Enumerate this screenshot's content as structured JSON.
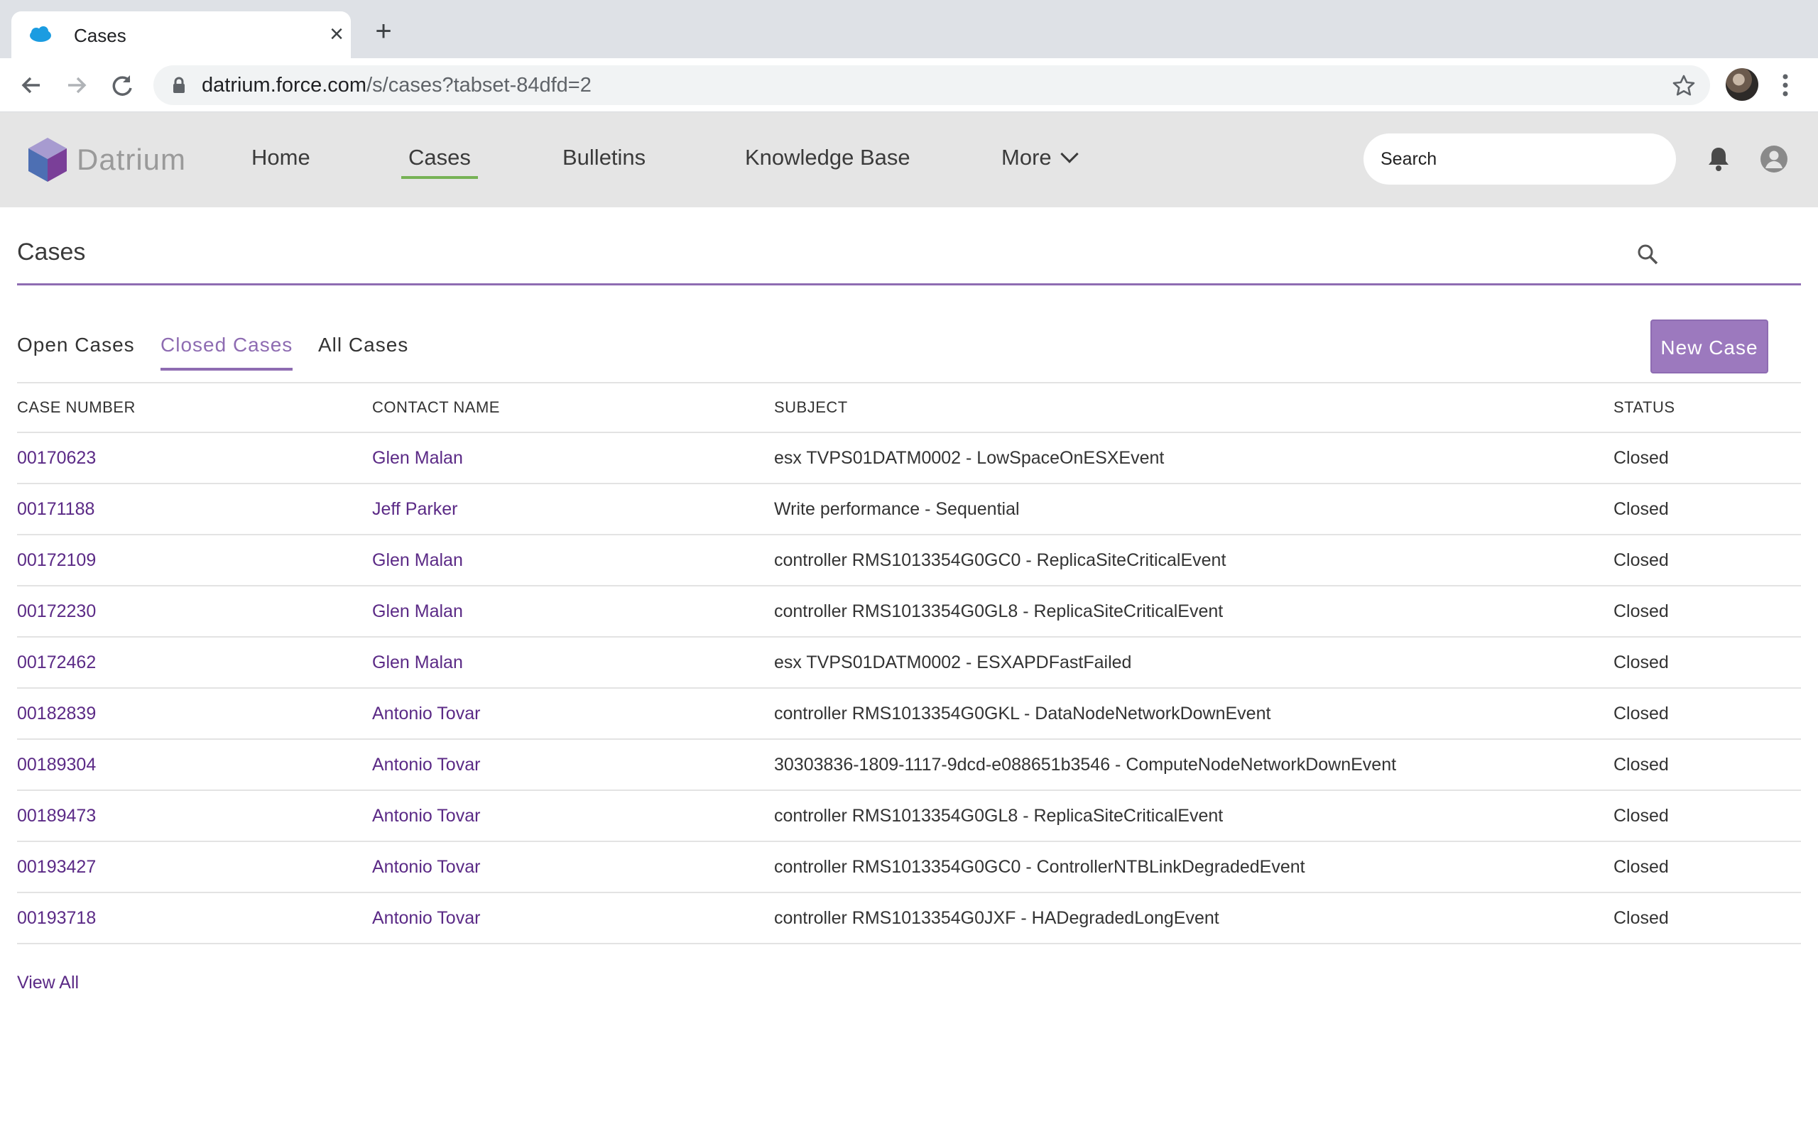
{
  "browser": {
    "tab_title": "Cases",
    "url_host": "datrium.force.com",
    "url_path": "/s/cases?tabset-84dfd=2"
  },
  "site": {
    "logo_text": "Datrium",
    "nav": [
      "Home",
      "Cases",
      "Bulletins",
      "Knowledge Base",
      "More"
    ],
    "search_placeholder": "Search"
  },
  "page": {
    "title": "Cases",
    "tabs": [
      "Open Cases",
      "Closed Cases",
      "All Cases"
    ],
    "active_tab": "Closed Cases",
    "new_case_label": "New Case",
    "view_all": "View All"
  },
  "table": {
    "headers": [
      "CASE NUMBER",
      "CONTACT NAME",
      "SUBJECT",
      "STATUS"
    ],
    "rows": [
      [
        "00170623",
        "Glen Malan",
        "esx TVPS01DATM0002 - LowSpaceOnESXEvent",
        "Closed"
      ],
      [
        "00171188",
        "Jeff Parker",
        "Write performance - Sequential",
        "Closed"
      ],
      [
        "00172109",
        "Glen Malan",
        "controller RMS1013354G0GC0 - ReplicaSiteCriticalEvent",
        "Closed"
      ],
      [
        "00172230",
        "Glen Malan",
        "controller RMS1013354G0GL8 - ReplicaSiteCriticalEvent",
        "Closed"
      ],
      [
        "00172462",
        "Glen Malan",
        "esx TVPS01DATM0002 - ESXAPDFastFailed",
        "Closed"
      ],
      [
        "00182839",
        "Antonio Tovar",
        "controller RMS1013354G0GKL - DataNodeNetworkDownEvent",
        "Closed"
      ],
      [
        "00189304",
        "Antonio Tovar",
        "30303836-1809-1117-9dcd-e088651b3546 - ComputeNodeNetworkDownEvent",
        "Closed"
      ],
      [
        "00189473",
        "Antonio Tovar",
        "controller RMS1013354G0GL8 - ReplicaSiteCriticalEvent",
        "Closed"
      ],
      [
        "00193427",
        "Antonio Tovar",
        "controller RMS1013354G0GC0 - ControllerNTBLinkDegradedEvent",
        "Closed"
      ],
      [
        "00193718",
        "Antonio Tovar",
        "controller RMS1013354G0JXF - HADegradedLongEvent",
        "Closed"
      ]
    ]
  },
  "colors": {
    "accent": "#8e6cb2",
    "link": "#5b2a86",
    "nav_active": "#77b255"
  }
}
